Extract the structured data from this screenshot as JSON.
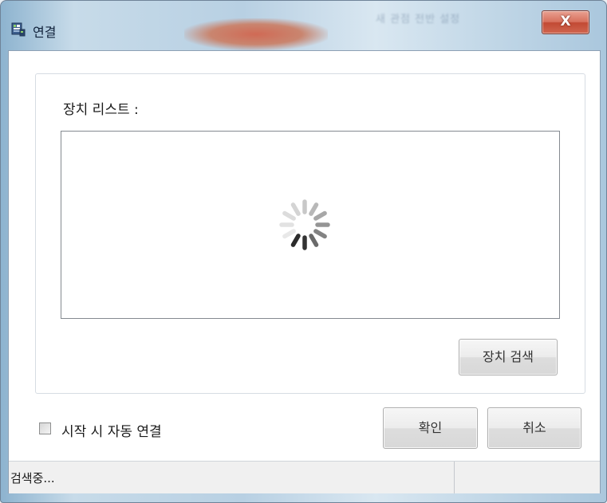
{
  "window": {
    "title": "연결",
    "close_label": "X",
    "title_icon": "app-window-icon"
  },
  "background_text": "새 관점 전반 설정",
  "device_list": {
    "label": "장치 리스트 :",
    "loading_icon": "loading-spinner-icon",
    "items": []
  },
  "buttons": {
    "search_device": "장치 검색",
    "ok": "확인",
    "cancel": "취소"
  },
  "auto_connect": {
    "label": "시작 시 자동 연결",
    "checked": false
  },
  "status": {
    "text": "검색중..."
  },
  "colors": {
    "close_button": "#c24a34",
    "window_frame": "#b8d0e3",
    "client_background": "#ffffff",
    "statusbar_background": "#f0f0f0"
  }
}
